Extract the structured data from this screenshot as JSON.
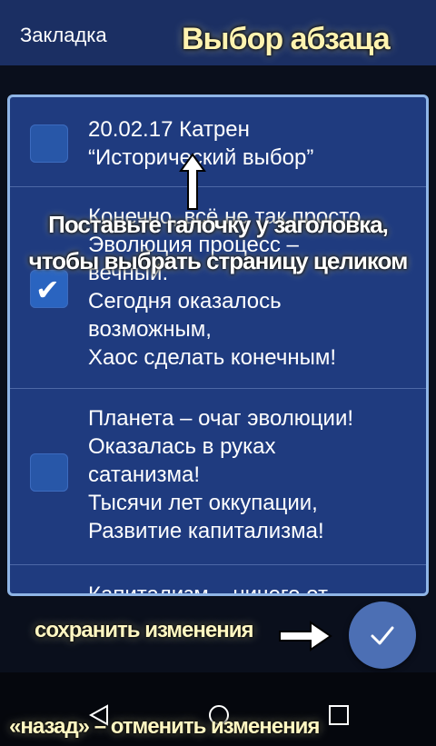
{
  "appbar": {
    "title": "Закладка"
  },
  "overlay": {
    "title": "Выбор абзаца",
    "hint_line1": "Поставьте галочку у заголовка,",
    "hint_line2": "чтобы выбрать страницу целиком",
    "save_hint": "сохранить изменения",
    "back_hint": "«назад» – отменить изменения"
  },
  "rows": [
    {
      "lines": [
        "20.02.17 Катрен",
        "“Исторический выбор”"
      ],
      "checked": false
    },
    {
      "lines": [
        "Конечно, всё не так просто,",
        "Эволюция процесс –",
        "вечный.",
        "Сегодня оказалось",
        "возможным,",
        "Хаос сделать конечным!"
      ],
      "checked": true
    },
    {
      "lines": [
        "Планета – очаг эволюции!",
        "Оказалась в руках",
        "сатанизма!",
        "Тысячи лет оккупации,",
        "Развитие капитализма!"
      ],
      "checked": false
    },
    {
      "lines": [
        "Капитализм – ничего от"
      ],
      "checked": false
    }
  ],
  "icons": {
    "checkmark": "✔",
    "fab": "check-icon",
    "nav": [
      "back-icon",
      "home-icon",
      "recents-icon"
    ]
  },
  "colors": {
    "appbar": "#1b2f63",
    "panel": "#1f3b7f",
    "checkbox": "#2857a8",
    "fab": "#4c6fb4",
    "overlay_text": "#fff3b0"
  }
}
